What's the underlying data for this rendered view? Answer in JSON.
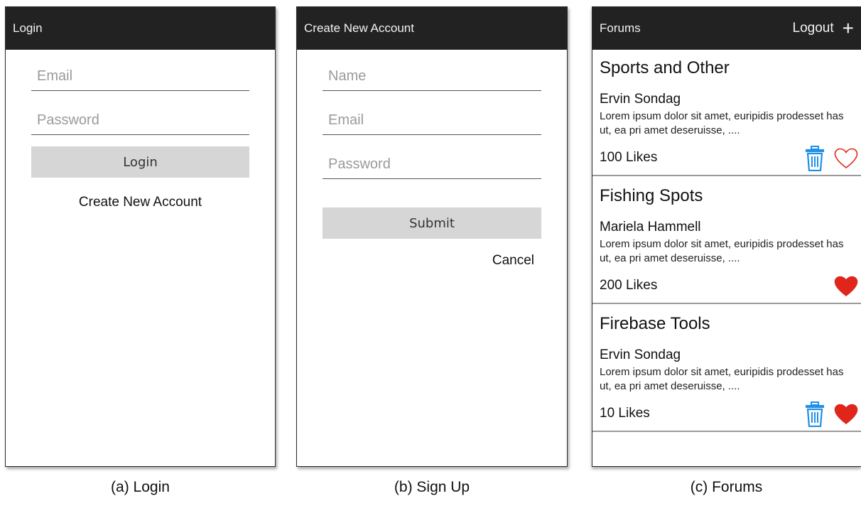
{
  "login": {
    "title": "Login",
    "email_placeholder": "Email",
    "password_placeholder": "Password",
    "login_button": "Login",
    "create_account_link": "Create New Account"
  },
  "signup": {
    "title": "Create New Account",
    "name_placeholder": "Name",
    "email_placeholder": "Email",
    "password_placeholder": "Password",
    "submit_button": "Submit",
    "cancel_link": "Cancel"
  },
  "forums": {
    "title": "Forums",
    "logout_label": "Logout",
    "add_label": "+",
    "items": [
      {
        "title": "Sports and Other",
        "author": "Ervin Sondag",
        "body": "Lorem ipsum dolor sit amet, euripidis prodesset has ut, ea pri amet deseruisse, ....",
        "likes": "100 Likes",
        "has_delete": true,
        "liked": false
      },
      {
        "title": "Fishing Spots",
        "author": "Mariela Hammell",
        "body": "Lorem ipsum dolor sit amet, euripidis prodesset has ut, ea pri amet deseruisse, ....",
        "likes": "200 Likes",
        "has_delete": false,
        "liked": true
      },
      {
        "title": "Firebase Tools",
        "author": "Ervin Sondag",
        "body": "Lorem ipsum dolor sit amet, euripidis prodesset has ut, ea pri amet deseruisse, ....",
        "likes": "10 Likes",
        "has_delete": true,
        "liked": true
      }
    ]
  },
  "captions": {
    "login": "(a) Login",
    "signup": "(b) Sign Up",
    "forums": "(c) Forums"
  },
  "colors": {
    "titlebar": "#222222",
    "button_gray": "#d6d6d6",
    "trash_blue": "#1e90e6",
    "heart_red": "#e0251b"
  },
  "icons": {
    "delete": "trash-icon",
    "like_empty": "heart-outline-icon",
    "like_filled": "heart-filled-icon",
    "add": "plus-icon"
  }
}
